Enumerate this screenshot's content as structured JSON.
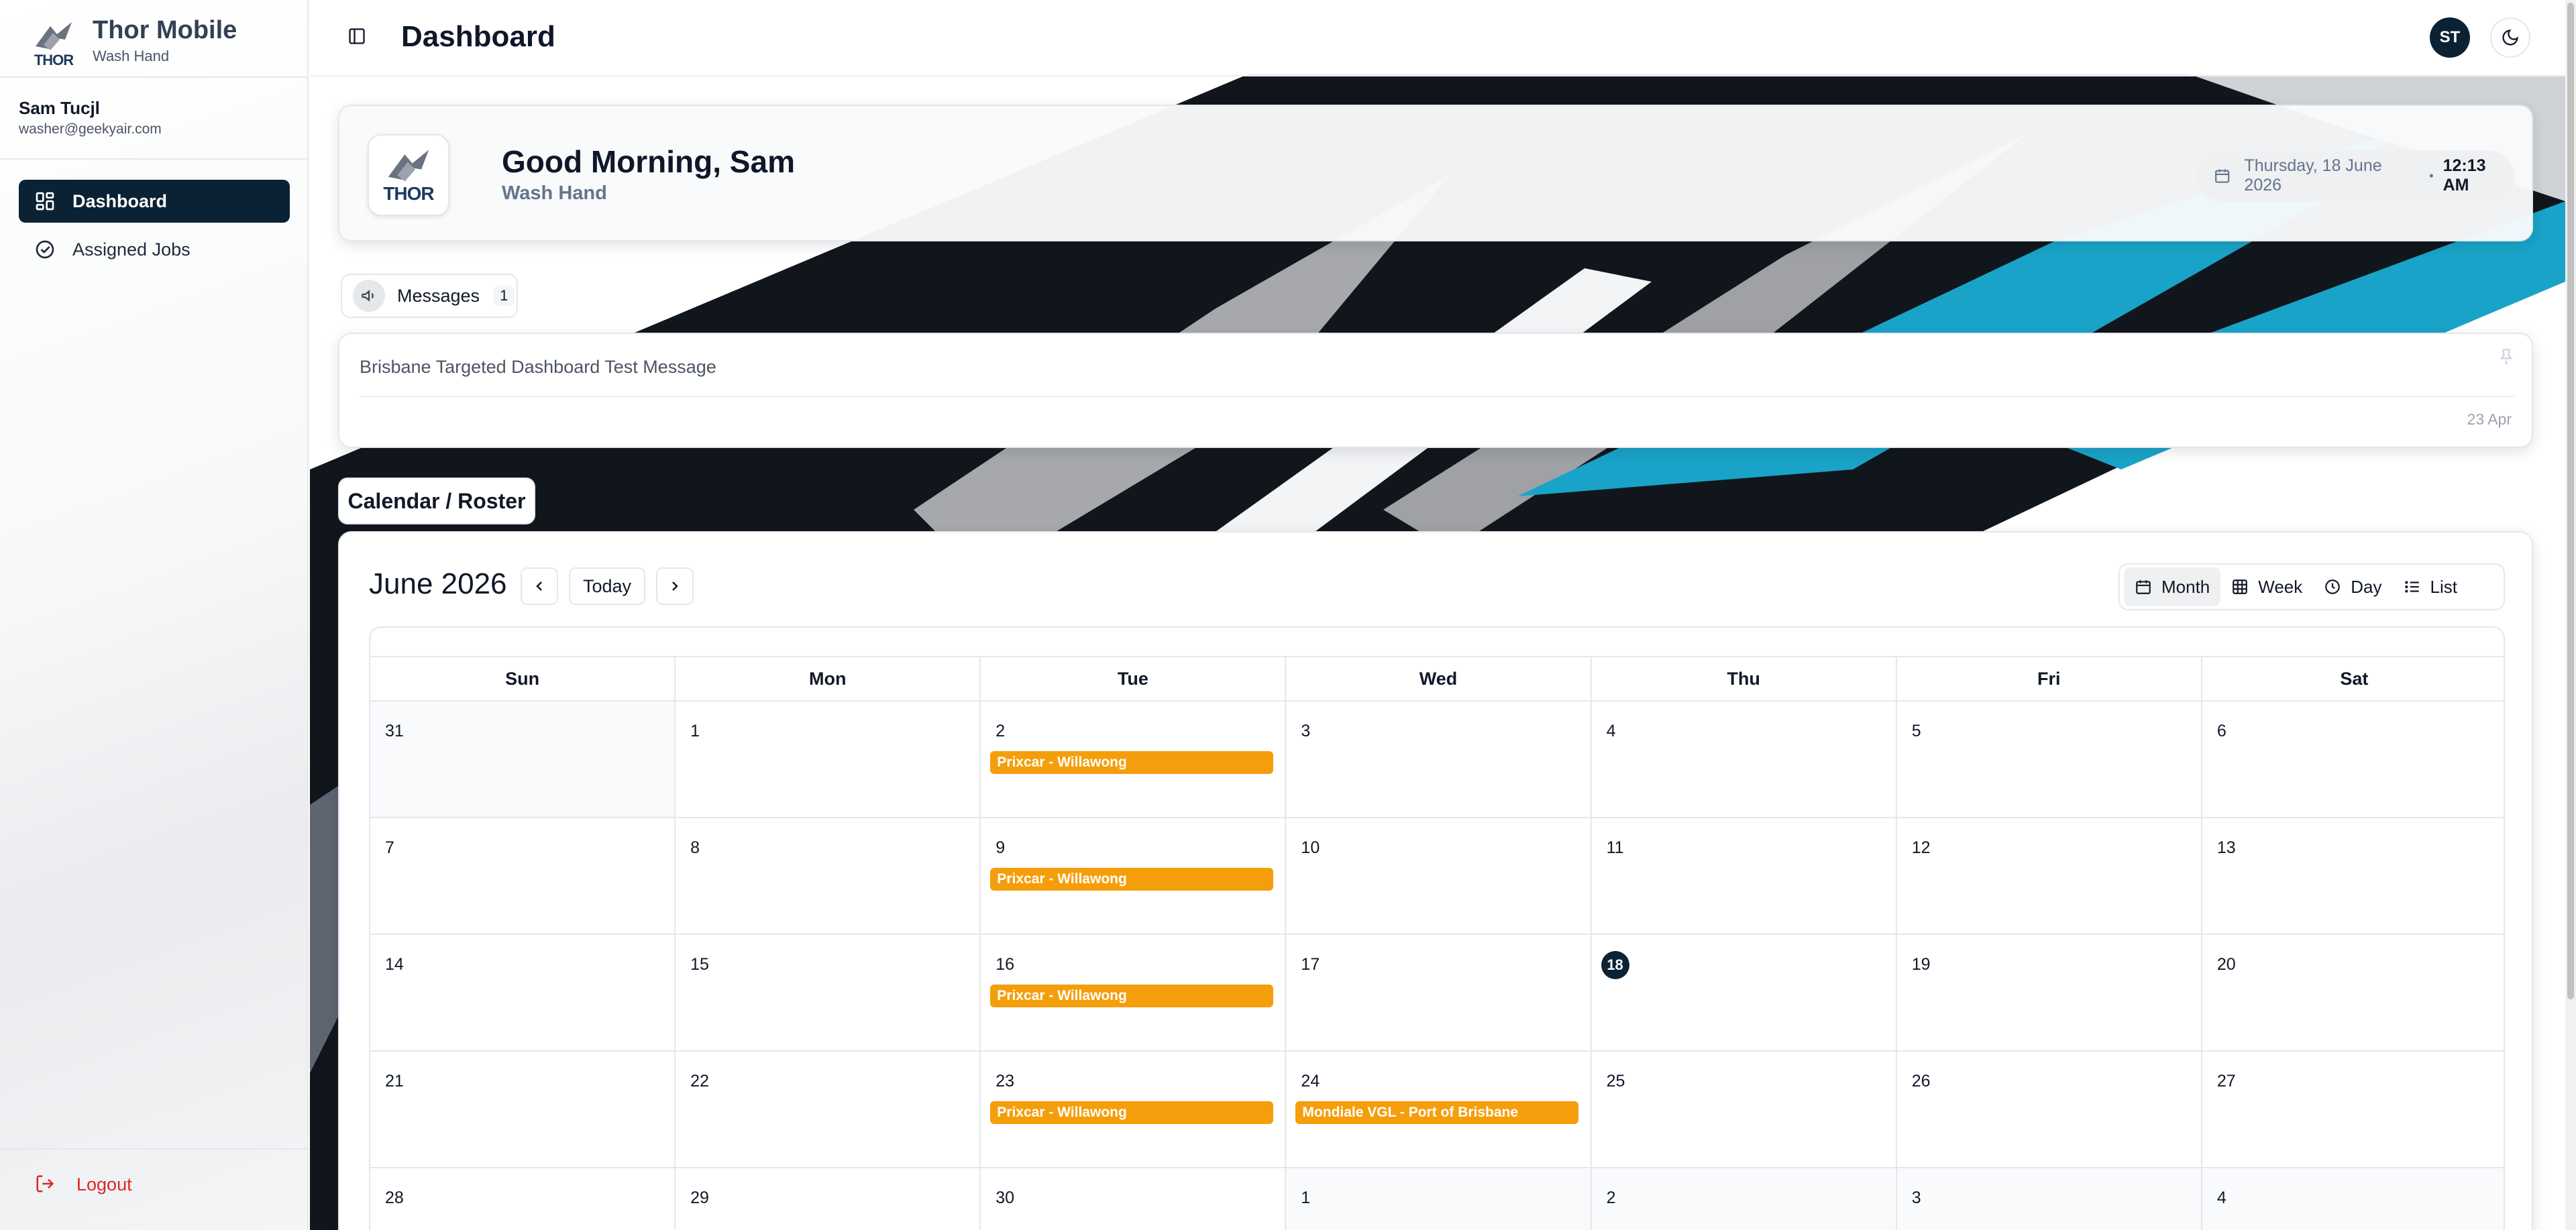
{
  "app": {
    "title": "Thor Mobile",
    "subtitle": "Wash Hand",
    "logo_text": "THOR"
  },
  "user": {
    "name": "Sam Tucjl",
    "email": "washer@geekyair.com",
    "initials": "ST"
  },
  "nav": {
    "items": [
      {
        "label": "Dashboard",
        "icon": "grid-icon",
        "active": true
      },
      {
        "label": "Assigned Jobs",
        "icon": "check-circle-icon",
        "active": false
      }
    ],
    "logout": "Logout"
  },
  "header": {
    "title": "Dashboard"
  },
  "greeting": {
    "title": "Good Morning, Sam",
    "subtitle": "Wash Hand",
    "date": "Thursday, 18 June 2026",
    "separator": "•",
    "time": "12:13 AM"
  },
  "messages": {
    "label": "Messages",
    "count": "1",
    "items": [
      {
        "text": "Brisbane Targeted Dashboard Test Message",
        "date": "23 Apr"
      }
    ]
  },
  "calendar": {
    "section_label": "Calendar / Roster",
    "month_label": "June 2026",
    "today_label": "Today",
    "views": [
      "Month",
      "Week",
      "Day",
      "List"
    ],
    "active_view": "Month",
    "weekdays": [
      "Sun",
      "Mon",
      "Tue",
      "Wed",
      "Thu",
      "Fri",
      "Sat"
    ],
    "weeks": [
      [
        {
          "d": "31",
          "o": true
        },
        {
          "d": "1"
        },
        {
          "d": "2",
          "events": [
            "Prixcar - Willawong"
          ]
        },
        {
          "d": "3"
        },
        {
          "d": "4"
        },
        {
          "d": "5"
        },
        {
          "d": "6"
        }
      ],
      [
        {
          "d": "7"
        },
        {
          "d": "8"
        },
        {
          "d": "9",
          "events": [
            "Prixcar - Willawong"
          ]
        },
        {
          "d": "10"
        },
        {
          "d": "11"
        },
        {
          "d": "12"
        },
        {
          "d": "13"
        }
      ],
      [
        {
          "d": "14"
        },
        {
          "d": "15"
        },
        {
          "d": "16",
          "events": [
            "Prixcar - Willawong"
          ]
        },
        {
          "d": "17"
        },
        {
          "d": "18",
          "today": true
        },
        {
          "d": "19"
        },
        {
          "d": "20"
        }
      ],
      [
        {
          "d": "21"
        },
        {
          "d": "22"
        },
        {
          "d": "23",
          "events": [
            "Prixcar - Willawong"
          ]
        },
        {
          "d": "24",
          "events": [
            "Mondiale VGL - Port of Brisbane"
          ]
        },
        {
          "d": "25"
        },
        {
          "d": "26"
        },
        {
          "d": "27"
        }
      ],
      [
        {
          "d": "28"
        },
        {
          "d": "29"
        },
        {
          "d": "30"
        },
        {
          "d": "1",
          "o": true
        },
        {
          "d": "2",
          "o": true
        },
        {
          "d": "3",
          "o": true
        },
        {
          "d": "4",
          "o": true
        }
      ]
    ],
    "event_color": "#f59e0b"
  },
  "colors": {
    "primary": "#0b2235",
    "danger": "#dc2626",
    "accent": "#1aa3c8"
  }
}
